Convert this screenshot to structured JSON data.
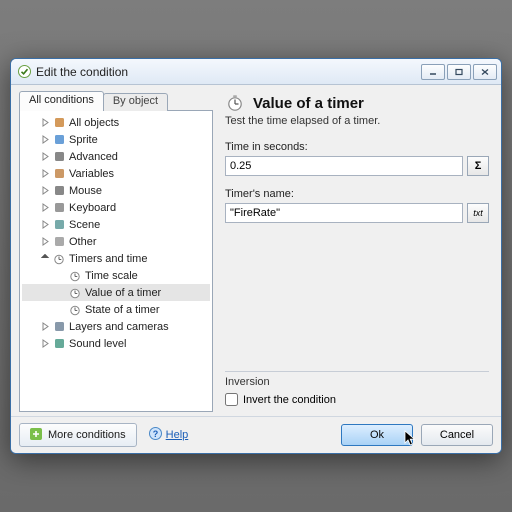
{
  "window": {
    "title": "Edit the condition"
  },
  "tabs": {
    "all": "All conditions",
    "by_object": "By object"
  },
  "tree": {
    "items": [
      {
        "label": "All objects",
        "expandable": true,
        "expanded": false,
        "icon": "box"
      },
      {
        "label": "Sprite",
        "expandable": true,
        "expanded": false,
        "icon": "sprite"
      },
      {
        "label": "Advanced",
        "expandable": true,
        "expanded": false,
        "icon": "gear"
      },
      {
        "label": "Variables",
        "expandable": true,
        "expanded": false,
        "icon": "var"
      },
      {
        "label": "Mouse",
        "expandable": true,
        "expanded": false,
        "icon": "mouse"
      },
      {
        "label": "Keyboard",
        "expandable": true,
        "expanded": false,
        "icon": "keyboard"
      },
      {
        "label": "Scene",
        "expandable": true,
        "expanded": false,
        "icon": "scene"
      },
      {
        "label": "Other",
        "expandable": true,
        "expanded": false,
        "icon": "dot"
      },
      {
        "label": "Timers and time",
        "expandable": true,
        "expanded": true,
        "icon": "clock",
        "children": [
          {
            "label": "Time scale",
            "icon": "clock"
          },
          {
            "label": "Value of a timer",
            "icon": "clock",
            "selected": true
          },
          {
            "label": "State of a timer",
            "icon": "clock"
          }
        ]
      },
      {
        "label": "Layers and cameras",
        "expandable": true,
        "expanded": false,
        "icon": "layers"
      },
      {
        "label": "Sound level",
        "expandable": true,
        "expanded": false,
        "icon": "sound"
      }
    ]
  },
  "panel": {
    "title": "Value of a timer",
    "description": "Test the time elapsed of a timer.",
    "field1_label": "Time in seconds:",
    "field1_value": "0.25",
    "field1_btn": "Σ",
    "field2_label": "Timer's name:",
    "field2_value": "\"FireRate\"",
    "field2_btn": "txt",
    "inversion_group": "Inversion",
    "invert_label": "Invert the condition"
  },
  "footer": {
    "more": "More conditions",
    "help": "Help",
    "ok": "Ok",
    "cancel": "Cancel"
  }
}
